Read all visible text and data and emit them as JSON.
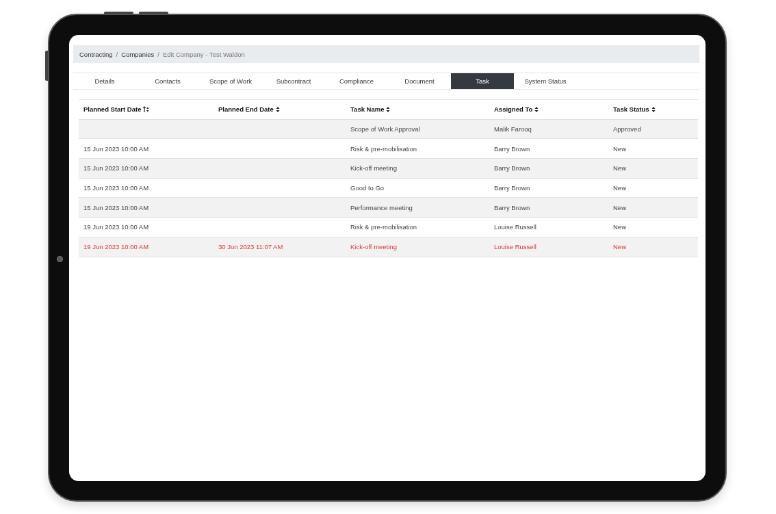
{
  "breadcrumb": [
    {
      "label": "Contracting",
      "current": false
    },
    {
      "separator": "/",
      "label": "Companies",
      "current": false
    },
    {
      "separator": "/",
      "label": "Edit Company - Test Waldon",
      "current": true
    }
  ],
  "tabs": [
    {
      "label": "Details",
      "selected": false
    },
    {
      "label": "Contacts",
      "selected": false
    },
    {
      "label": "Scope of Work",
      "selected": false
    },
    {
      "label": "Subcontract",
      "selected": false
    },
    {
      "label": "Compliance",
      "selected": false
    },
    {
      "label": "Document",
      "selected": false
    },
    {
      "label": "Task",
      "selected": true
    },
    {
      "label": "System Status",
      "selected": false
    }
  ],
  "table": {
    "columns": [
      {
        "label": "Planned Start Date",
        "sorted": true
      },
      {
        "label": "Planned End Date",
        "sorted": false
      },
      {
        "label": "Task Name",
        "sorted": false
      },
      {
        "label": "Assigned To",
        "sorted": false
      },
      {
        "label": "Task Status",
        "sorted": false
      }
    ],
    "rows": [
      {
        "overdue": false,
        "cells": [
          "",
          "",
          "Scope of Work Approval",
          "Malik Farooq",
          "Approved"
        ]
      },
      {
        "overdue": false,
        "cells": [
          "15 Jun 2023 10:00 AM",
          "",
          "Risk & pre-mobilisation",
          "Barry Brown",
          "New"
        ]
      },
      {
        "overdue": false,
        "cells": [
          "15 Jun 2023 10:00 AM",
          "",
          "Kick-off meeting",
          "Barry Brown",
          "New"
        ]
      },
      {
        "overdue": false,
        "cells": [
          "15 Jun 2023 10:00 AM",
          "",
          "Good to Go",
          "Barry Brown",
          "New"
        ]
      },
      {
        "overdue": false,
        "cells": [
          "15 Jun 2023 10:00 AM",
          "",
          "Performance meeting",
          "Barry Brown",
          "New"
        ]
      },
      {
        "overdue": false,
        "cells": [
          "19 Jun 2023 10:00 AM",
          "",
          "Risk & pre-mobilisation",
          "Louise Russell",
          "New"
        ]
      },
      {
        "overdue": true,
        "cells": [
          "19 Jun 2023 10:00 AM",
          "30 Jun 2023 11:07 AM",
          "Kick-off meeting",
          "Louise Russell",
          "New"
        ]
      }
    ]
  }
}
